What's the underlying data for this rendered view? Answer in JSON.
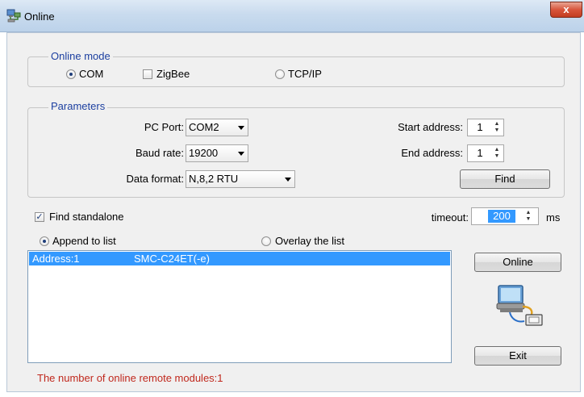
{
  "window": {
    "title": "Online",
    "close_glyph": "x"
  },
  "online_mode": {
    "title": "Online mode",
    "options": [
      {
        "label": "COM",
        "kind": "radio",
        "checked": true
      },
      {
        "label": "ZigBee",
        "kind": "checkbox",
        "checked": false
      },
      {
        "label": "TCP/IP",
        "kind": "radio",
        "checked": false
      }
    ]
  },
  "parameters": {
    "title": "Parameters",
    "pc_port": {
      "label": "PC Port:",
      "value": "COM2"
    },
    "baud_rate": {
      "label": "Baud rate:",
      "value": "19200"
    },
    "data_format": {
      "label": "Data format:",
      "value": "N,8,2 RTU"
    },
    "start_address": {
      "label": "Start address:",
      "value": "1"
    },
    "end_address": {
      "label": "End address:",
      "value": "1"
    },
    "find_button": "Find"
  },
  "find_standalone": {
    "label": "Find standalone",
    "checked": true,
    "check_glyph": "✓"
  },
  "timeout": {
    "label": "timeout:",
    "value": "200",
    "unit": "ms"
  },
  "list_mode": {
    "append": {
      "label": "Append to list",
      "checked": true
    },
    "overlay": {
      "label": "Overlay the list",
      "checked": false
    }
  },
  "device_list": {
    "rows": [
      {
        "address": "Address:1",
        "model": "SMC-C24ET(-e)",
        "selected": true
      }
    ]
  },
  "buttons": {
    "online": "Online",
    "exit": "Exit"
  },
  "status": {
    "text": "The number of online remote modules:1",
    "color": "#c0281d"
  },
  "icons": {
    "app": "network-computer-icon",
    "connection": "computer-connection-icon",
    "spin": "spin-arrows-icon",
    "dropdown": "chevron-down-icon"
  },
  "colors": {
    "accent_blue": "#1c3fa0",
    "selection": "#3399ff",
    "close_red": "#c8432a"
  }
}
